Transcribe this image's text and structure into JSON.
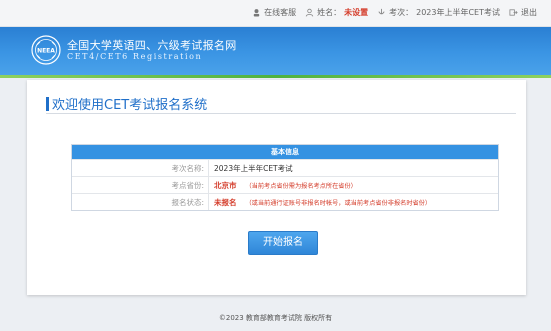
{
  "topbar": {
    "online_help": "在线客服",
    "name_label": "姓名：",
    "name_value": "未设置",
    "exam_label": "考次：",
    "exam_value": "2023年上半年CET考试",
    "logout": "退出"
  },
  "header": {
    "title": "全国大学英语四、六级考试报名网",
    "subtitle": "CET4/CET6 Registration",
    "logo_text": "NEEA"
  },
  "main": {
    "welcome": "欢迎使用CET考试报名系统",
    "info": {
      "heading": "基本信息",
      "rows": [
        {
          "label": "考次名称:",
          "value": "2023年上半年CET考试",
          "note": ""
        },
        {
          "label": "考点省份:",
          "value": "北京市",
          "note": "（当前考点省份需为报名考点所在省份）"
        },
        {
          "label": "报名状态:",
          "value": "未报名",
          "note": "（或当前通行证账号非报名时帐号，或当前考点省份非报名时省份）"
        }
      ]
    },
    "start_button": "开始报名"
  },
  "footer": {
    "text": "©2023  教育部教育考试院  版权所有"
  },
  "colors": {
    "brand_blue": "#2a7fd3",
    "accent_green": "#4fb23f",
    "alert_red": "#d43c2a"
  }
}
